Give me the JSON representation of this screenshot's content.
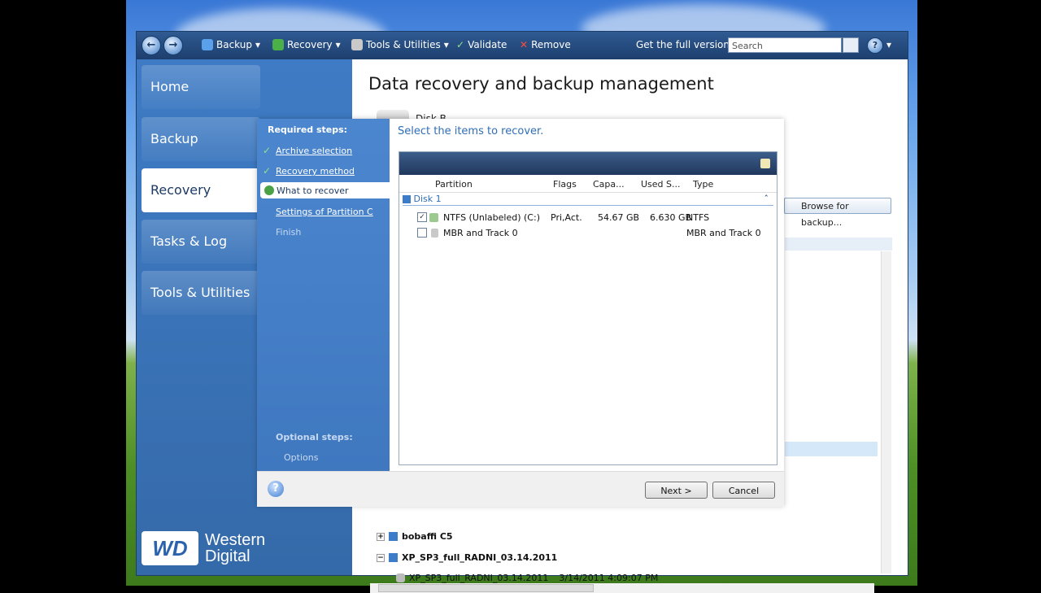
{
  "toolbar": {
    "backup": "Backup",
    "recovery": "Recovery",
    "tools": "Tools & Utilities",
    "validate": "Validate",
    "remove": "Remove",
    "full_version": "Get the full version",
    "search_placeholder": "Search"
  },
  "sidebar": {
    "items": [
      {
        "label": "Home"
      },
      {
        "label": "Backup"
      },
      {
        "label": "Recovery"
      },
      {
        "label": "Tasks & Log"
      },
      {
        "label": "Tools & Utilities"
      }
    ],
    "brand": {
      "line1": "Western",
      "line2": "Digital",
      "logo": "WD"
    }
  },
  "main": {
    "title": "Data recovery and backup management",
    "disk_label_partial": "Disk B",
    "browse_button": "Browse for backup...",
    "tree": [
      {
        "name": "bobaffi C5",
        "bold": true
      },
      {
        "name": "XP_SP3_full_RADNI_03.14.2011",
        "bold": true
      },
      {
        "name": "XP_SP3_full_RADNI_03.14.2011",
        "date": "3/14/2011 4:09:07 PM"
      }
    ]
  },
  "wizard": {
    "required_title": "Required steps:",
    "steps": [
      {
        "label": "Archive selection",
        "done": true
      },
      {
        "label": "Recovery method",
        "done": true
      },
      {
        "label": "What to recover",
        "current": true
      },
      {
        "label": "Settings of Partition C"
      },
      {
        "label": "Finish"
      }
    ],
    "optional_title": "Optional steps:",
    "optional": [
      {
        "label": "Options"
      }
    ],
    "heading": "Select the items to recover.",
    "columns": [
      "Partition",
      "Flags",
      "Capa...",
      "Used S...",
      "Type"
    ],
    "group": "Disk 1",
    "rows": [
      {
        "partition": "NTFS (Unlabeled) (C:)",
        "flags": "Pri,Act.",
        "capacity": "54.67 GB",
        "used": "6.630 GB",
        "type": "NTFS",
        "checked": true
      },
      {
        "partition": "MBR and Track 0",
        "flags": "",
        "capacity": "",
        "used": "",
        "type": "MBR and Track 0",
        "checked": false
      }
    ],
    "next": "Next >",
    "cancel": "Cancel"
  }
}
